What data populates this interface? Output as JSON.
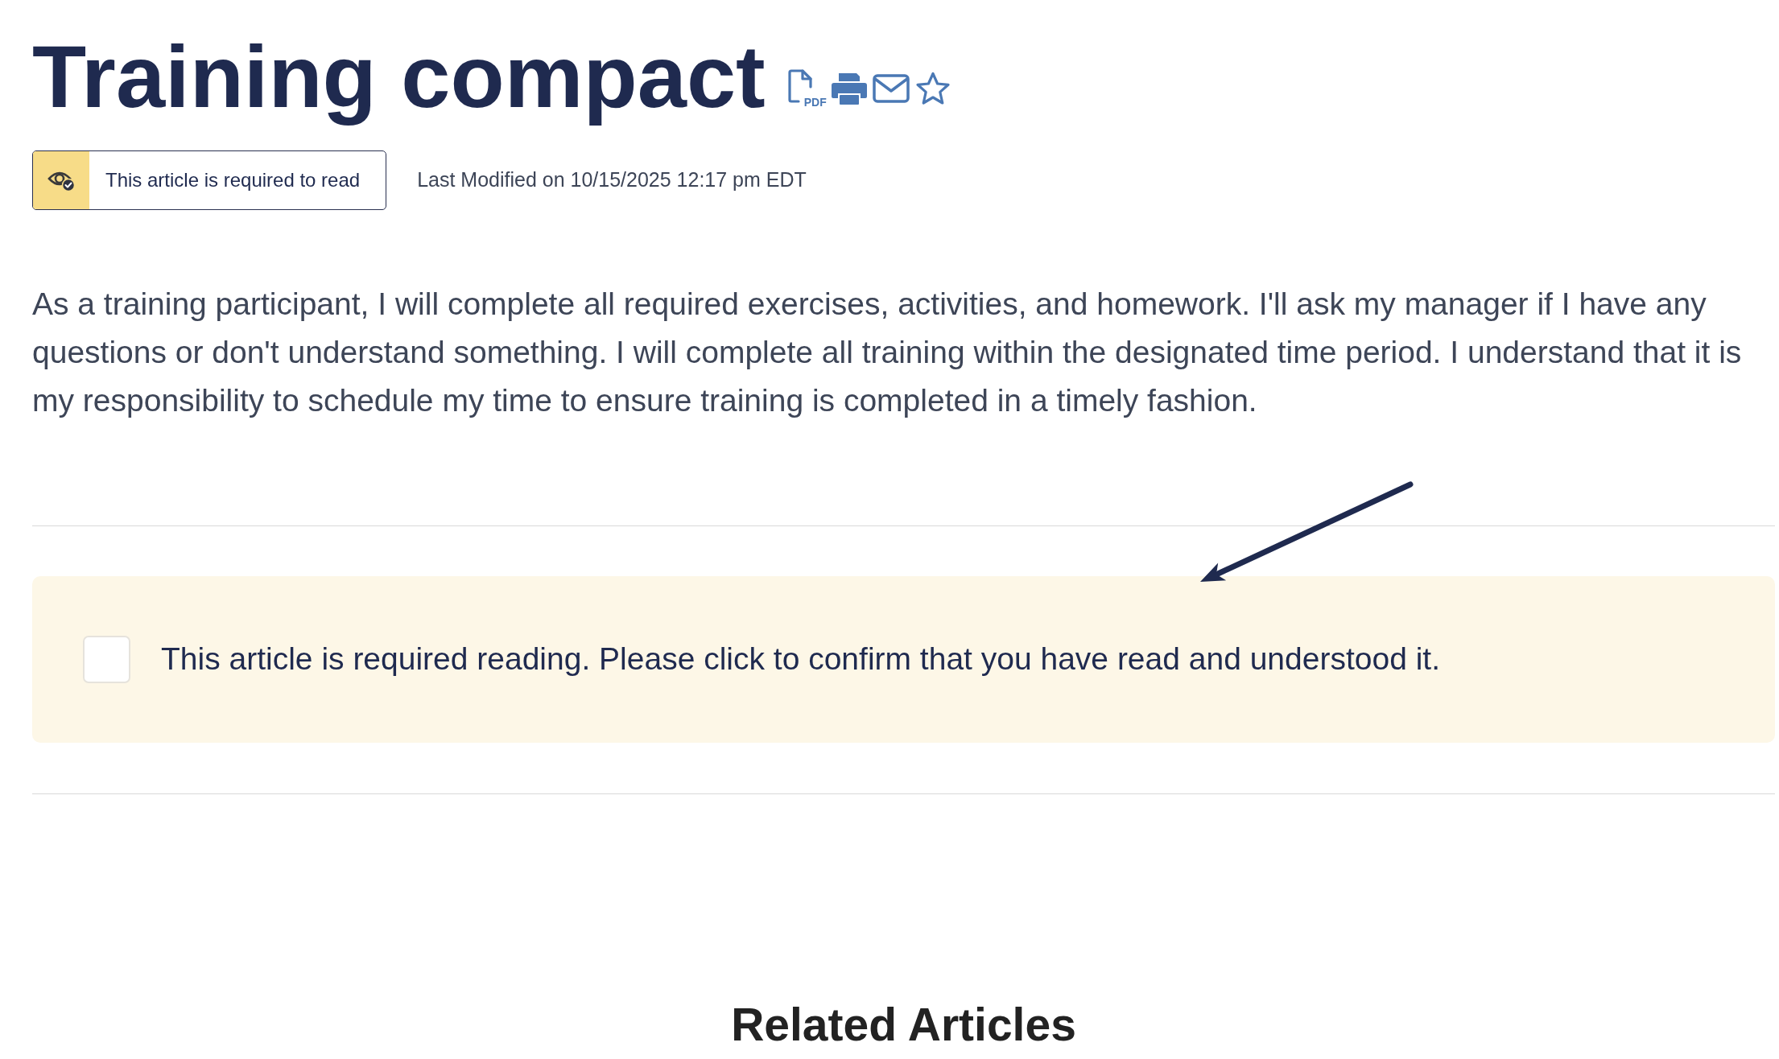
{
  "title": "Training compact",
  "actions": [
    {
      "kind": "pdf",
      "label": "PDF"
    },
    {
      "kind": "print"
    },
    {
      "kind": "email"
    }
  ],
  "favorite": {
    "on": false
  },
  "required_badge": {
    "label": "This article is required to read"
  },
  "last_modified": "Last Modified on 10/15/2025 12:17 pm EDT",
  "body": "As a training participant, I will complete all required exercises, activities, and homework. I'll ask my manager if I have any questions or don't understand something. I will complete all training within the designated time period. I understand that it is my responsibility to schedule my time to ensure training is completed in a timely fashion.",
  "confirmation": {
    "label": "This article is required reading. Please click to confirm that you have read and understood it.",
    "checked": false
  },
  "related_articles": {
    "heading": "Related Articles"
  }
}
